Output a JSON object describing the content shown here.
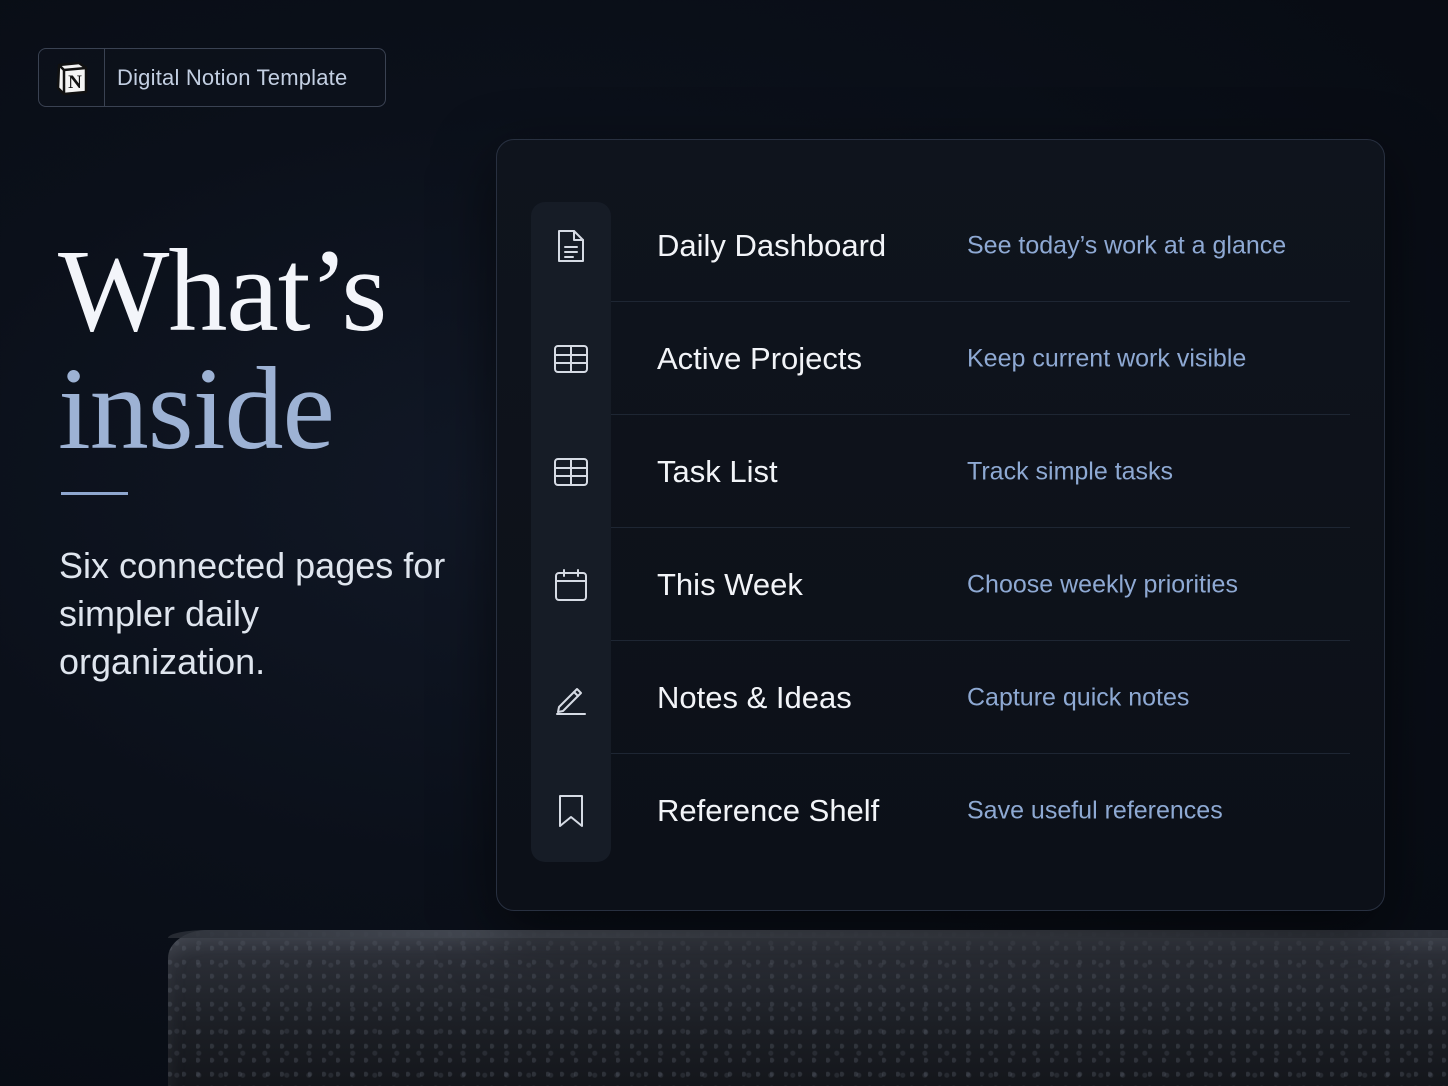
{
  "badge": {
    "logo_letter": "N",
    "label": "Digital Notion Template"
  },
  "headline": {
    "line1": "What’s",
    "line2": "inside"
  },
  "subtitle": "Six connected pages for simpler daily organization.",
  "colors": {
    "background": "#0b101a",
    "accent": "#9db2d4",
    "description": "#8ea9d3"
  },
  "pages": [
    {
      "icon": "document-icon",
      "title": "Daily Dashboard",
      "description": "See today’s work at a glance"
    },
    {
      "icon": "table-icon",
      "title": "Active Projects",
      "description": "Keep current work visible"
    },
    {
      "icon": "table-icon",
      "title": "Task List",
      "description": "Track simple tasks"
    },
    {
      "icon": "calendar-icon",
      "title": "This Week",
      "description": "Choose weekly priorities"
    },
    {
      "icon": "pencil-icon",
      "title": "Notes & Ideas",
      "description": "Capture quick notes"
    },
    {
      "icon": "bookmark-icon",
      "title": "Reference Shelf",
      "description": "Save useful references"
    }
  ]
}
